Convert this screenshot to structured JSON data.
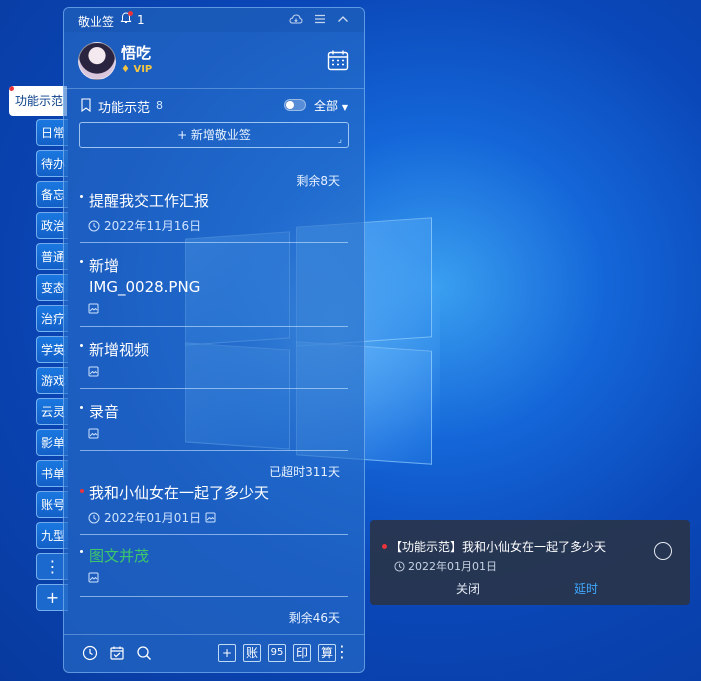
{
  "app": {
    "name": "敬业签",
    "notification_count": "1"
  },
  "user": {
    "name": "悟吃",
    "badge": "VIP"
  },
  "sidebar": {
    "active_tab": "功能示范",
    "tabs": [
      "日常",
      "待办",
      "备忘",
      "政治",
      "普通",
      "变态",
      "治疗",
      "学英",
      "游戏",
      "云灵",
      "影单",
      "书单",
      "账号",
      "九型"
    ],
    "more_label": "⋮",
    "add_label": "+"
  },
  "category": {
    "label": "功能示范",
    "count": "8",
    "filter": "全部"
  },
  "add_note_label": "+ 新增敬业签",
  "notes": [
    {
      "group_label": "剩余8天",
      "title": "提醒我交工作汇报",
      "date": "2022年11月16日"
    },
    {
      "title_line1": "新增",
      "title_line2": "IMG_0028.PNG"
    },
    {
      "title": "新增视频"
    },
    {
      "title": "录音"
    },
    {
      "group_label": "已超时311天",
      "title": "我和小仙女在一起了多少天",
      "date": "2022年01月01日"
    },
    {
      "title": "图文并茂"
    }
  ],
  "bottom_group_label": "剩余46天",
  "toolbar": {
    "add": "+",
    "ledger": "账",
    "num": "95",
    "print": "印",
    "calc": "算",
    "more": "⋮"
  },
  "toast": {
    "message": "【功能示范】我和小仙女在一起了多少天",
    "date": "2022年01月01日",
    "close_label": "关闭",
    "delay_label": "延时"
  },
  "colors": {
    "accent": "#3fa9ff",
    "green_text": "#3cc86a",
    "alert": "#e8343a",
    "vip": "#f5c542"
  }
}
